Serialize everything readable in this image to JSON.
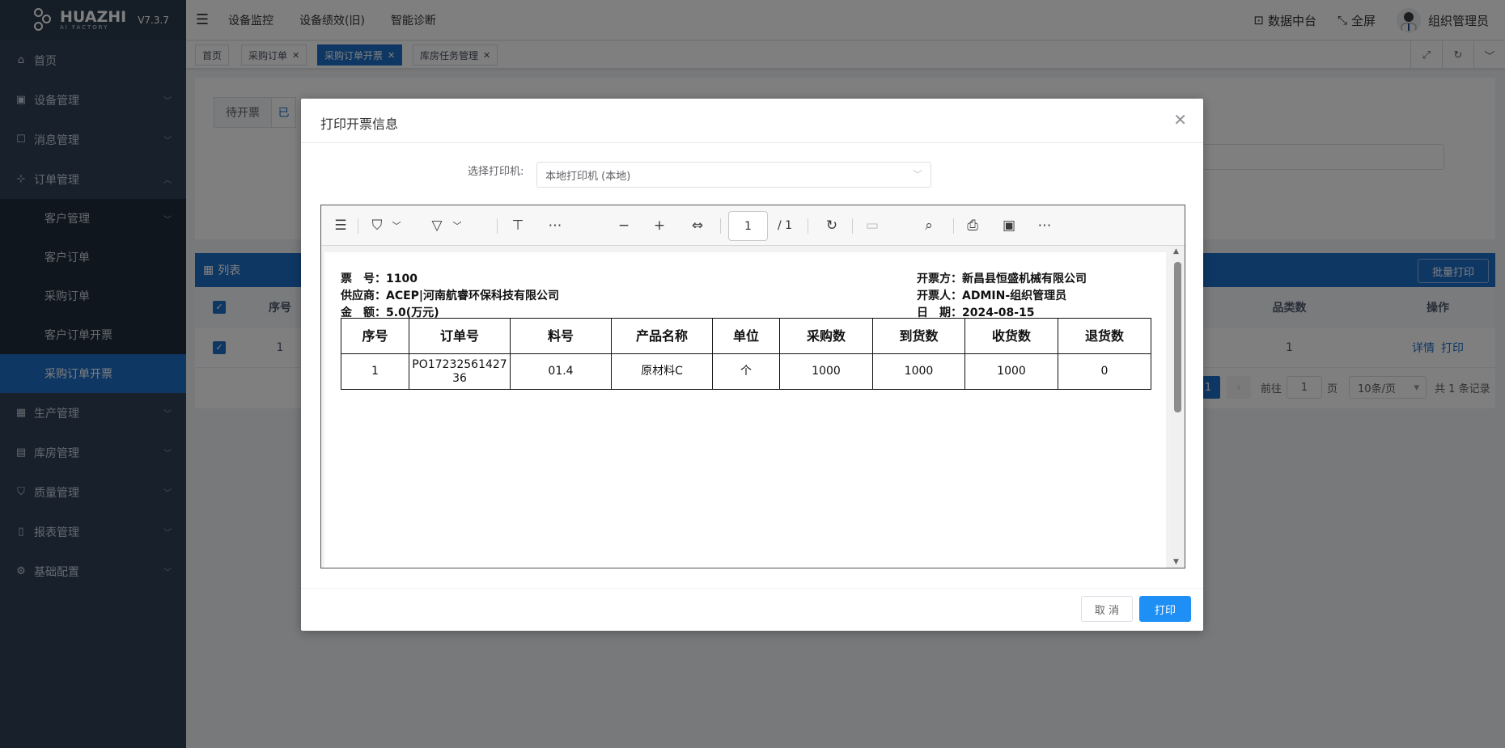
{
  "app": {
    "brand": "HUAZHI",
    "brand_sub": "AI FACTORY",
    "version": "V7.3.7"
  },
  "sidebar": {
    "items": [
      {
        "label": "首页",
        "icon": "home-icon"
      },
      {
        "label": "设备管理",
        "icon": "monitor-icon"
      },
      {
        "label": "消息管理",
        "icon": "message-icon"
      },
      {
        "label": "订单管理",
        "icon": "org-icon"
      },
      {
        "label": "生产管理",
        "icon": "calendar-icon"
      },
      {
        "label": "库房管理",
        "icon": "warehouse-icon"
      },
      {
        "label": "质量管理",
        "icon": "shield-icon"
      },
      {
        "label": "报表管理",
        "icon": "report-icon"
      },
      {
        "label": "基础配置",
        "icon": "gear-icon"
      }
    ],
    "sub": [
      "客户管理",
      "客户订单",
      "采购订单",
      "客户订单开票",
      "采购订单开票"
    ]
  },
  "topbar": {
    "nav": [
      "设备监控",
      "设备绩效(旧)",
      "智能诊断"
    ],
    "data_center": "数据中台",
    "fullscreen": "全屏",
    "user": "组织管理员"
  },
  "tags": [
    "首页",
    "采购订单",
    "采购订单开票",
    "库房任务管理"
  ],
  "page": {
    "subtab_pending": "待开票",
    "subtab_done": "已",
    "list_title": "列表",
    "batch_print": "批量打印",
    "col_seq": "序号",
    "col_category": "品类数",
    "col_action": "操作",
    "row_seq": "1",
    "row_category": "1",
    "row_detail": "详情",
    "row_print": "打印",
    "pager_current": "1",
    "pager_goto": "前往",
    "pager_goto_value": "1",
    "pager_page_unit": "页",
    "pager_size": "10条/页",
    "pager_total": "共 1 条记录"
  },
  "dialog": {
    "title": "打印开票信息",
    "printer_label": "选择打印机:",
    "printer_value": "本地打印机 (本地)",
    "page_current": "1",
    "page_total": "/ 1",
    "cancel": "取 消",
    "print": "打印"
  },
  "invoice": {
    "no_label": "票　号：",
    "no": "1100",
    "supplier_label": "供应商：",
    "supplier": "ACEP|河南航睿环保科技有限公司",
    "amount_label": "金　额：",
    "amount": "5.0(万元)",
    "issuer_label": "开票方：",
    "issuer": "新昌县恒盛机械有限公司",
    "operator_label": "开票人：",
    "operator": "ADMIN-组织管理员",
    "date_label": "日　期：",
    "date": "2024-08-15",
    "headers": [
      "序号",
      "订单号",
      "料号",
      "产品名称",
      "单位",
      "采购数",
      "到货数",
      "收货数",
      "退货数"
    ],
    "row": [
      "1",
      "PO1723256142736",
      "01.4",
      "原材料C",
      "个",
      "1000",
      "1000",
      "1000",
      "0"
    ]
  }
}
